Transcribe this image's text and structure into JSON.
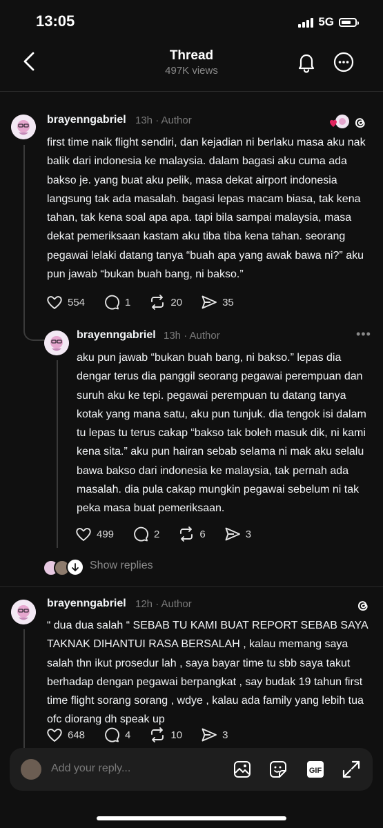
{
  "status": {
    "time": "13:05",
    "network": "5G"
  },
  "header": {
    "title": "Thread",
    "views": "497K views"
  },
  "posts": [
    {
      "username": "brayenngabriel",
      "time": "13h",
      "author": "Author",
      "text": "first time naik flight sendiri, dan kejadian ni berlaku masa aku nak balik dari indonesia ke malaysia. dalam bagasi aku cuma ada bakso je. yang buat aku pelik, masa dekat airport indonesia langsung tak ada masalah. bagasi lepas macam biasa, tak kena tahan, tak kena soal apa apa. tapi bila sampai malaysia, masa dekat pemeriksaan kastam aku tiba tiba kena tahan. seorang pegawai lelaki datang tanya “buah apa yang awak bawa ni?” aku pun jawab “bukan buah bang, ni bakso.”",
      "likes": "554",
      "replies": "1",
      "reposts": "20",
      "shares": "35"
    },
    {
      "username": "brayenngabriel",
      "time": "13h",
      "author": "Author",
      "text": "aku pun jawab “bukan buah bang, ni bakso.” lepas dia dengar terus dia panggil seorang pegawai perempuan dan suruh aku ke tepi. pegawai perempuan tu datang tanya kotak yang mana satu, aku pun tunjuk. dia tengok isi dalam tu lepas tu terus cakap “bakso tak boleh masuk dik, ni kami kena sita.” aku pun hairan sebab selama ni mak aku selalu bawa bakso dari indonesia ke malaysia, tak pernah ada masalah. dia pula cakap mungkin pegawai sebelum ni tak peka masa buat pemeriksaan.",
      "likes": "499",
      "replies": "2",
      "reposts": "6",
      "shares": "3",
      "more": "•••"
    },
    {
      "username": "brayenngabriel",
      "time": "12h",
      "author": "Author",
      "text": "“ dua dua salah “ SEBAB TU KAMI BUAT REPORT SEBAB SAYA TAKNAK DIHANTUI RASA BERSALAH , kalau memang saya salah thn ikut prosedur lah , saya bayar time tu sbb saya takut berhadap dengan pegawai berpangkat , say budak 19 tahun first time flight sorang sorang , wdye , kalau ada family yang lebih tua ofc diorang dh speak up",
      "likes": "648",
      "replies": "4",
      "reposts": "10",
      "shares": "3"
    }
  ],
  "show_replies": "Show replies",
  "reply_bar": {
    "placeholder": "Add your reply..."
  },
  "icons": [
    "back-chevron-icon",
    "bell-icon",
    "more-icon",
    "heart-icon",
    "comment-icon",
    "repost-icon",
    "share-icon",
    "threads-logo-icon",
    "image-icon",
    "sticker-icon",
    "gif-icon",
    "expand-icon",
    "arrow-down-icon"
  ],
  "colors": {
    "background": "#101010",
    "text": "#f3f5f7",
    "secondary": "#7a7a7a",
    "reply_bar": "#1e1e1e",
    "heart_red": "#e0245e"
  }
}
